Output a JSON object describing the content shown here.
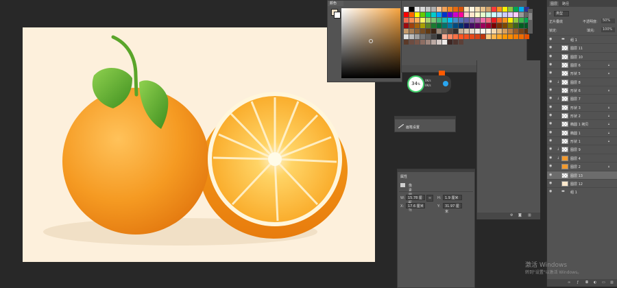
{
  "color_panel": {
    "tab_label": "颜色",
    "hue_color": "#f7a43f"
  },
  "swatches": {
    "colors": [
      "#ffffff",
      "#000000",
      "#ececec",
      "#d9d9d9",
      "#c4c4c4",
      "#b0b0b0",
      "#f7c9a0",
      "#f4a259",
      "#f08a24",
      "#e86a10",
      "#d9530b",
      "#ffe3b8",
      "#fff5e0",
      "#f5deb3",
      "#e8c38e",
      "#cfa16a",
      "#ff3b3b",
      "#f7941d",
      "#fff200",
      "#8dc63f",
      "#00a651",
      "#00aeef",
      "#2e3192",
      "#ff0000",
      "#ff6600",
      "#ffff00",
      "#66cc00",
      "#00cc66",
      "#00cccc",
      "#0099ff",
      "#0033cc",
      "#6600cc",
      "#cc00cc",
      "#ff0099",
      "#ffcccc",
      "#ffe5cc",
      "#ffffcc",
      "#e5ffcc",
      "#ccffe5",
      "#ccffff",
      "#cce5ff",
      "#ccccff",
      "#e5ccff",
      "#ffccff",
      "#999999",
      "#666666",
      "#f26c4f",
      "#f68e55",
      "#fbaf5c",
      "#fff467",
      "#acd372",
      "#7cc576",
      "#3bb878",
      "#1abbb4",
      "#00bff3",
      "#438ccb",
      "#5574b9",
      "#605ca8",
      "#855fa8",
      "#a763a8",
      "#f06ea9",
      "#f26d7d",
      "#ed1c24",
      "#f26522",
      "#f7941d",
      "#fff200",
      "#8dc63f",
      "#39b54a",
      "#00a651",
      "#9e0b0f",
      "#a0410d",
      "#a3620a",
      "#aba000",
      "#598527",
      "#197b30",
      "#007236",
      "#00746b",
      "#0076a3",
      "#004b80",
      "#003471",
      "#1b1464",
      "#440e62",
      "#630460",
      "#9e005d",
      "#9e0039",
      "#790000",
      "#7b2e00",
      "#7d4900",
      "#827b00",
      "#406618",
      "#005e20",
      "#005826",
      "#c69c6d",
      "#a67c52",
      "#8c6239",
      "#754c24",
      "#603913",
      "#3c2415",
      "#998675",
      "#736357",
      "#534741",
      "#362f2d",
      "#c7b299",
      "#d9c9b0",
      "#e6dccd",
      "#f2ece2",
      "#fff7ee",
      "#fdf0dc",
      "#f3d9b1",
      "#e9bf82",
      "#d9a05b",
      "#c07f3e",
      "#9c5d26",
      "#7a4418",
      "#5b300f",
      "#e0e0e0",
      "#bdbdbd",
      "#9e9e9e",
      "#757575",
      "#616161",
      "#424242",
      "#212121",
      "#ffab91",
      "#ff8a65",
      "#ff7043",
      "#ff5722",
      "#f4511e",
      "#e64a19",
      "#d84315",
      "#bf360c",
      "#ffcc80",
      "#ffb74d",
      "#ffa726",
      "#ff9800",
      "#fb8c00",
      "#f57c00",
      "#ef6c00",
      "#e65100",
      "#5b3a29",
      "#6d4c41",
      "#795548",
      "#8d6e63",
      "#a1887f",
      "#bcaaa4",
      "#d7ccc8",
      "#efebe9",
      "#3e2723",
      "#4e342e",
      "#5d4037"
    ]
  },
  "perf": {
    "percent": "34",
    "unit": "%",
    "up": "0K/s",
    "down": "0K/s"
  },
  "brush": {
    "label": "画笔设置"
  },
  "properties": {
    "title": "属性",
    "subtitle": "像素图层属性",
    "w_label": "W:",
    "w_value": "15.78 厘米",
    "h_label": "H:",
    "h_value": "1.9 厘米",
    "x_label": "X:",
    "x_value": "17.6 厘米",
    "y_label": "Y:",
    "y_value": "31.97 厘米",
    "link_glyph": "∞"
  },
  "layers_panel": {
    "tab_layers": "图层",
    "tab_paths": "路径",
    "kind": "类型",
    "blend": "正片叠底",
    "opacity_label": "不透明度:",
    "opacity": "50%",
    "lock_label": "锁定:",
    "fill_label": "填充:",
    "fill": "100%",
    "layers": [
      {
        "name": "组 1",
        "type": "group",
        "clip": false,
        "lock": false,
        "selected": false
      },
      {
        "name": "图层 11",
        "type": "pixel",
        "clip": false,
        "lock": false,
        "selected": false
      },
      {
        "name": "图层 10",
        "type": "pixel",
        "clip": false,
        "lock": false,
        "selected": false
      },
      {
        "name": "图层 6",
        "type": "pixel",
        "clip": false,
        "lock": true,
        "selected": false
      },
      {
        "name": "形状 5",
        "type": "pixel",
        "clip": false,
        "lock": true,
        "selected": false
      },
      {
        "name": "图层 8",
        "type": "pixel",
        "clip": true,
        "lock": false,
        "selected": false
      },
      {
        "name": "形状 6",
        "type": "pixel",
        "clip": false,
        "lock": true,
        "selected": false
      },
      {
        "name": "图层 7",
        "type": "pixel",
        "clip": true,
        "lock": false,
        "selected": false
      },
      {
        "name": "形状 3",
        "type": "pixel",
        "clip": false,
        "lock": true,
        "selected": false
      },
      {
        "name": "形状 2",
        "type": "pixel",
        "clip": false,
        "lock": true,
        "selected": false
      },
      {
        "name": "椭圆 1 拷贝",
        "type": "pixel",
        "clip": false,
        "lock": true,
        "selected": false
      },
      {
        "name": "椭圆 1",
        "type": "pixel",
        "clip": false,
        "lock": true,
        "selected": false
      },
      {
        "name": "形状 1",
        "type": "pixel",
        "clip": false,
        "lock": true,
        "selected": false
      },
      {
        "name": "图层 9",
        "type": "pixel",
        "clip": true,
        "lock": false,
        "selected": false
      },
      {
        "name": "图层 4",
        "type": "orange",
        "clip": true,
        "lock": false,
        "selected": false
      },
      {
        "name": "图层 2",
        "type": "orange",
        "clip": false,
        "lock": true,
        "selected": false
      },
      {
        "name": "图层 13",
        "type": "pixel",
        "clip": false,
        "lock": false,
        "selected": true
      },
      {
        "name": "图层 12",
        "type": "cream",
        "clip": false,
        "lock": false,
        "selected": false
      },
      {
        "name": "组 1",
        "type": "group",
        "clip": false,
        "lock": false,
        "selected": false
      }
    ]
  },
  "watermark": {
    "line1": "激活 Windows",
    "line2": "转到\"设置\"以激活 Windows。"
  }
}
